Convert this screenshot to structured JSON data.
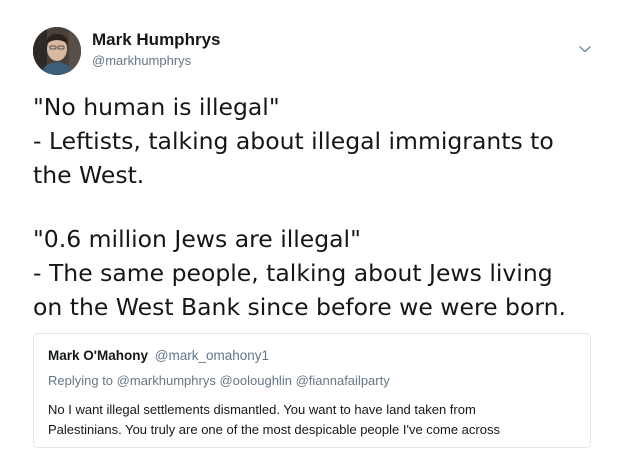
{
  "author": {
    "name": "Mark Humphrys",
    "handle": "@markhumphrys",
    "avatar_icon": "profile-photo"
  },
  "menu": {
    "icon": "chevron-down-icon"
  },
  "tweet": {
    "lines": [
      "\"No human is illegal\"",
      "- Leftists, talking about illegal immigrants to",
      "the West.",
      "\"0.6 million Jews are illegal\"",
      "- The same people, talking about Jews living",
      "on the West Bank since before we were born."
    ]
  },
  "quoted_tweet": {
    "author_name": "Mark O'Mahony",
    "author_handle": "@mark_omahony1",
    "replying_prefix": "Replying to",
    "replying_to": [
      "@markhumphrys",
      "@ooloughlin",
      "@fiannafailparty"
    ],
    "body_lines": [
      "No I want illegal settlements dismantled. You want to have land taken from",
      "Palestinians. You truly are one of the most despicable people I've come across"
    ]
  },
  "colors": {
    "text": "#14171a",
    "secondary": "#657786",
    "border": "#e1e8ed"
  }
}
